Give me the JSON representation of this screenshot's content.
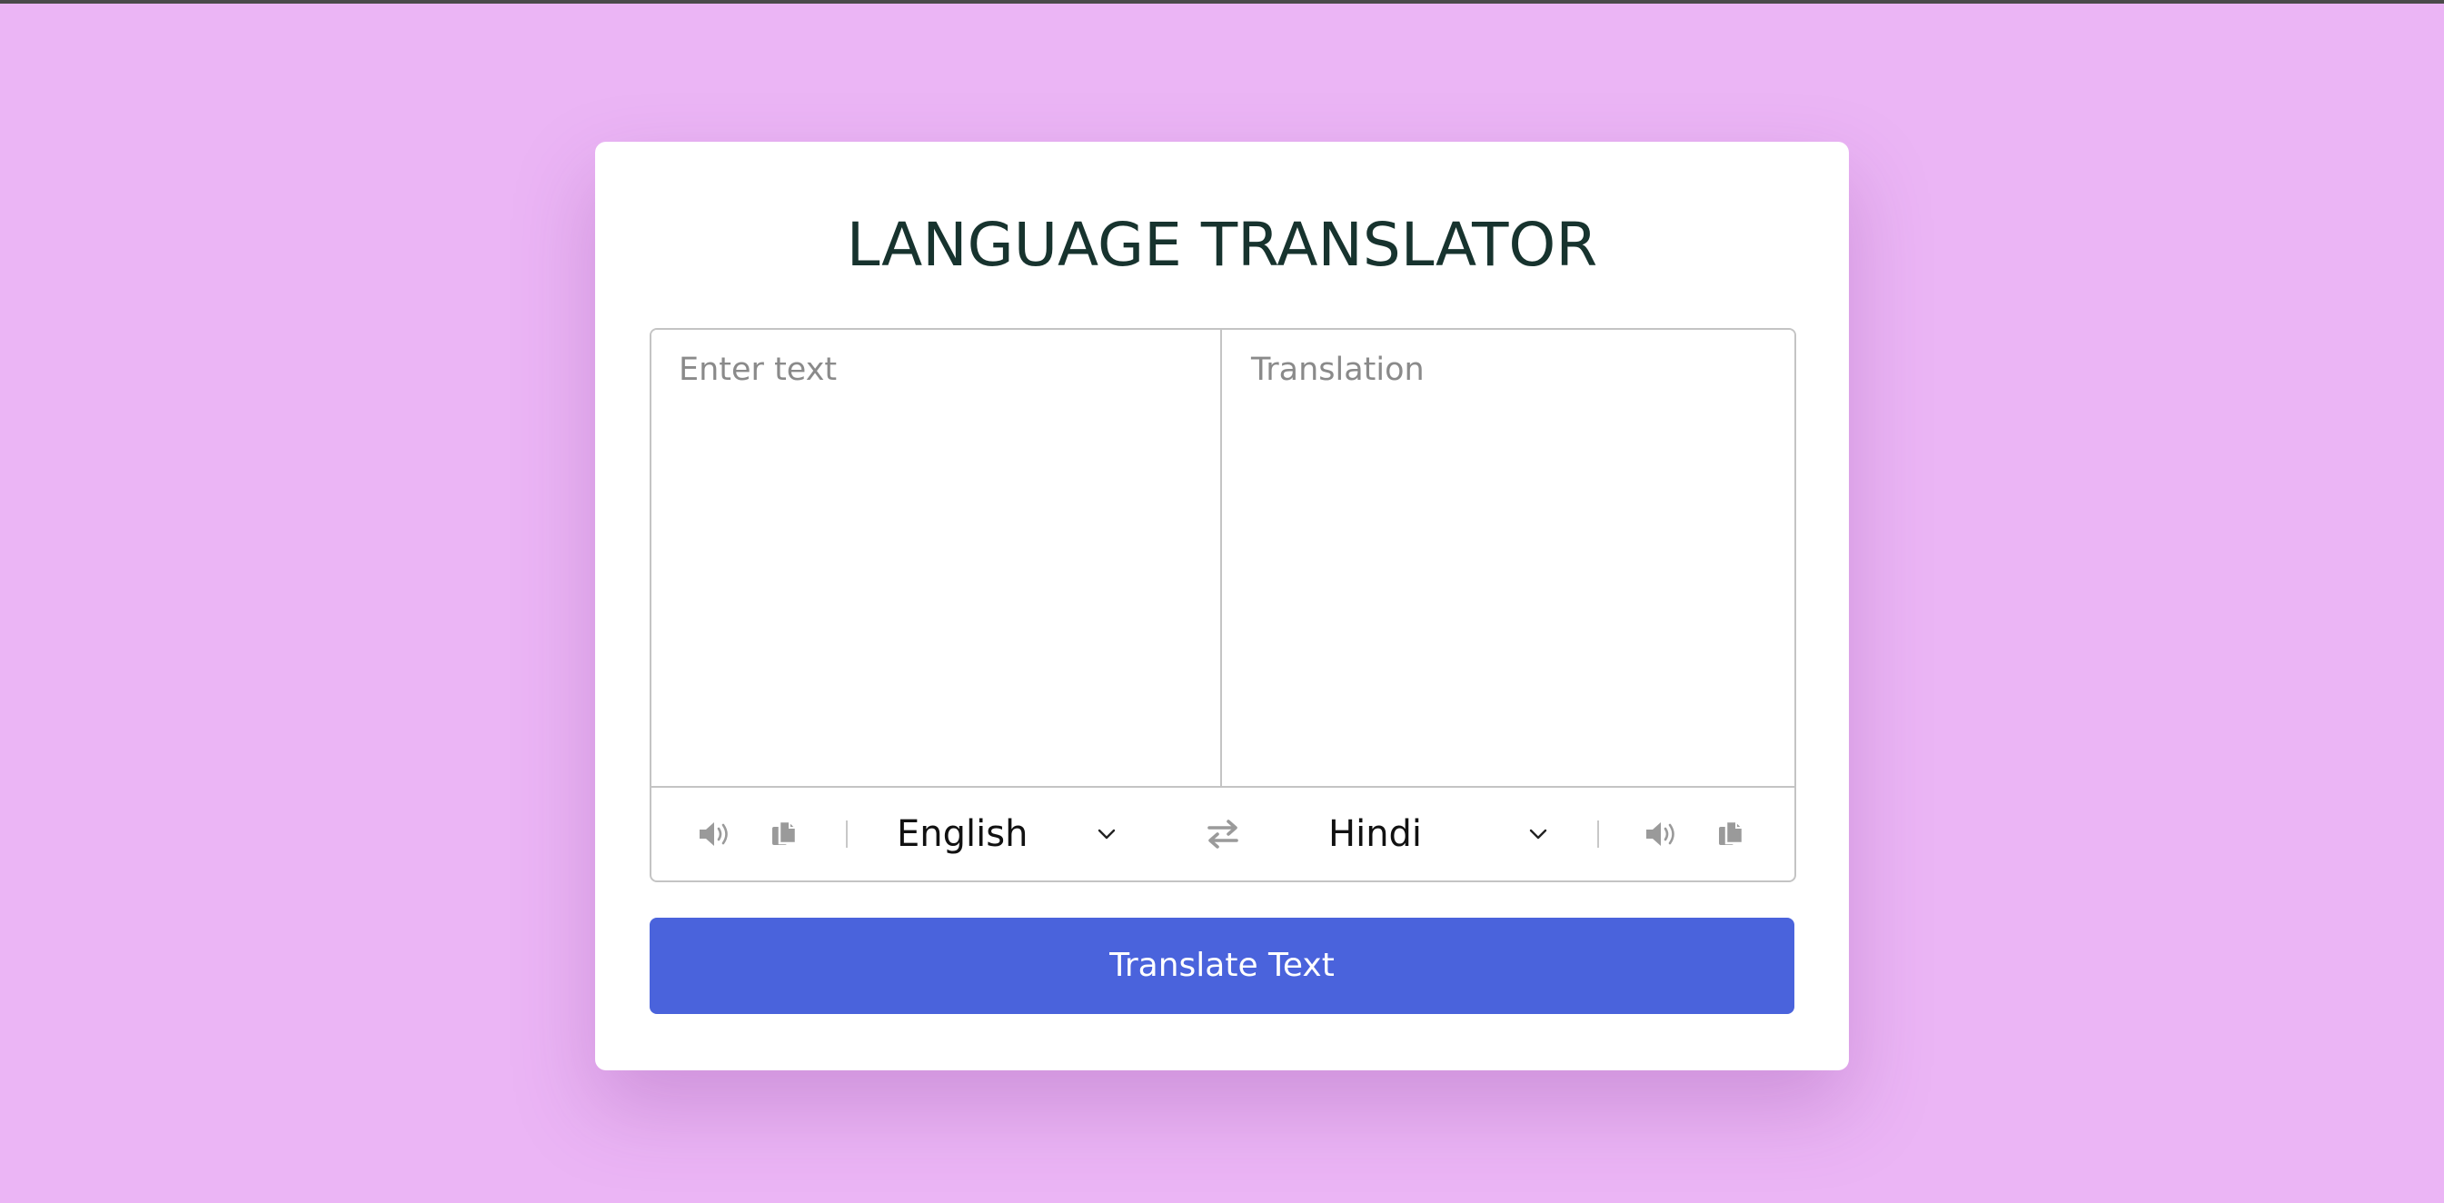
{
  "page": {
    "background_color": "#ebb5f5",
    "title": "LANGUAGE TRANSLATOR"
  },
  "input": {
    "from_placeholder": "Enter text",
    "from_value": "",
    "to_placeholder": "Translation",
    "to_value": ""
  },
  "controls": {
    "from_language": "English",
    "to_language": "Hindi",
    "icons": {
      "from_speak": "speaker-icon",
      "from_copy": "copy-icon",
      "swap": "exchange-icon",
      "to_speak": "speaker-icon",
      "to_copy": "copy-icon"
    },
    "icon_color": "#9a9a9a"
  },
  "button": {
    "label": "Translate Text",
    "color": "#4a63dc"
  }
}
